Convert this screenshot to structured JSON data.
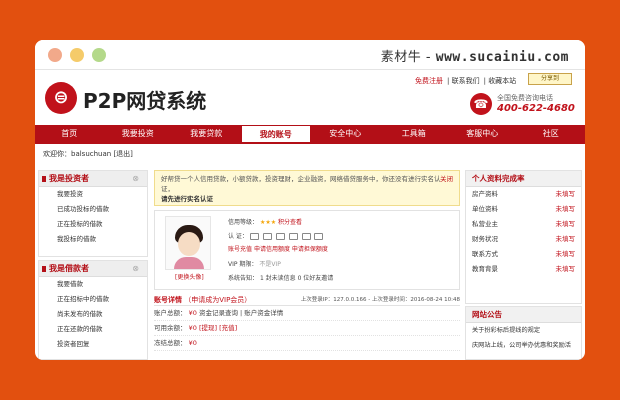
{
  "watermark": {
    "cn": "素材牛",
    "sep": " - ",
    "url": "www.sucainiu.com"
  },
  "header": {
    "logo_glyph": "⊜",
    "title": "P2P网贷系统",
    "links": [
      "免费注册",
      "联系我们",
      "收藏本站"
    ],
    "share_label": "分享到",
    "phone_glyph": "☎",
    "phone_caption": "全国免费咨询电话",
    "phone_number": "400-622-4680"
  },
  "nav": {
    "items": [
      "首页",
      "我要投资",
      "我要贷款",
      "我的账号",
      "安全中心",
      "工具箱",
      "客服中心",
      "社区"
    ],
    "active_index": 3
  },
  "welcome": {
    "text": "欢迎你：balsuchuan",
    "logout": "[退出]"
  },
  "left_panels": [
    {
      "title": "我是投资者",
      "items": [
        "我要投资",
        "已成功投标的借款",
        "正在投标的借款",
        "我投标的借款"
      ]
    },
    {
      "title": "我是借款者",
      "items": [
        "我要借款",
        "正在招标中的借款",
        "尚未发布的借款",
        "正在还款的借款",
        "投资者回复"
      ]
    }
  ],
  "notice": {
    "text": "好帮贷一个人信用贷款，小额贷款，投资理财，企业融资，网络借贷服务中，你还没有进行实名认证，",
    "strong": "请先进行实名认证",
    "close": "关闭"
  },
  "profile": {
    "avatar_label": "[更换头像]",
    "credit_label": "信用等级：",
    "credit_stars": "★★★",
    "credit_link": "积分查看",
    "auth_label": "认    证：",
    "actions": [
      "账号充值",
      "申请信用额度",
      "申请担保额度"
    ],
    "vip_label": "VIP 期限：",
    "vip_value": "不是VIP",
    "msg_label": "系统告知：",
    "msg_value": "1 封未读信息    0 位好友邀请"
  },
  "details": {
    "title": "账号详情",
    "vip_apply": "（申请成为VIP会员）",
    "last_login": "上次登录IP：127.0.0.166 - 上次登录时间：2016-08-24 10:48",
    "rows": [
      {
        "label": "账户总额：",
        "value": "¥0",
        "links": "资金记录查询 | 账户资金详情"
      },
      {
        "label": "可用余额：",
        "value": "¥0",
        "links": "[提现] [充值]"
      },
      {
        "label": "冻结总额：",
        "value": "¥0",
        "links": ""
      }
    ]
  },
  "right_panel": {
    "title": "个人资料完成率",
    "items": [
      {
        "label": "房产资料",
        "status": "未填写"
      },
      {
        "label": "单位资料",
        "status": "未填写"
      },
      {
        "label": "私营业主",
        "status": "未填写"
      },
      {
        "label": "财务状况",
        "status": "未填写"
      },
      {
        "label": "联系方式",
        "status": "未填写"
      },
      {
        "label": "教育背景",
        "status": "未填写"
      }
    ]
  },
  "announce": {
    "title": "网站公告",
    "items": [
      "关于扮彩标后提线的规定",
      "庆网站上线，公司举办优惠和奖励活"
    ]
  },
  "colors": {
    "brand": "#b30f17",
    "background": "#e2500f"
  }
}
